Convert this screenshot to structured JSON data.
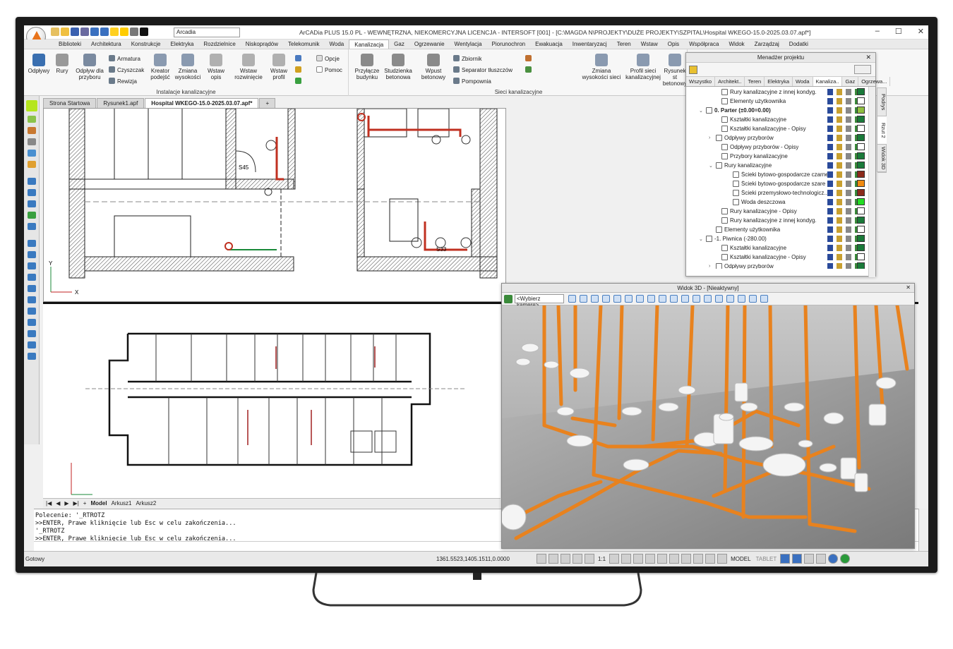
{
  "app": {
    "title": "ArCADia PLUS 15.0 PL - WEWNĘTRZNA, NIEKOMERCYJNA LICENCJA - INTERSOFT [001] - [C:\\MAGDA N\\PROJEKTY\\DUŻE PROJEKTY\\SZPITAL\\Hospital WKEGO-15.0-2025.03.07.apf*]",
    "font_selector": "Arcadia"
  },
  "menu": [
    "Biblioteki",
    "Architektura",
    "Konstrukcje",
    "Elektryka",
    "Rozdzielnice",
    "Niskoprądów",
    "Telekomunik",
    "Woda",
    "Kanalizacja",
    "Gaz",
    "Ogrzewanie",
    "Wentylacja",
    "Piorunochron",
    "Ewakuacja",
    "Inwentaryzacj",
    "Teren",
    "Wstaw",
    "Opis",
    "Współpraca",
    "Widok",
    "Zarządzaj",
    "Dodatki"
  ],
  "menu_active": "Kanalizacja",
  "ribbon": {
    "odplywy": "Odpływy",
    "rury": "Rury",
    "odplyw_przyb_1": "Odpływ dla",
    "odplyw_przyb_2": "przyboru",
    "armatura": "Armatura",
    "czyszczak": "Czyszczak",
    "rewizja": "Rewizja",
    "kreator_1": "Kreator",
    "kreator_2": "podejść",
    "zmiana_wys_1": "Zmiana",
    "zmiana_wys_2": "wysokości",
    "wstaw_opis_1": "Wstaw",
    "wstaw_opis_2": "opis",
    "wstaw_rozw_1": "Wstaw",
    "wstaw_rozw_2": "rozwinięcie",
    "wstaw_profil_1": "Wstaw",
    "wstaw_profil_2": "profil",
    "opcje": "Opcje",
    "pomoc": "Pomoc",
    "group_instalacje": "Instalacje kanalizacyjne",
    "przylacze_1": "Przyłącze",
    "przylacze_2": "budynku",
    "studzienka_1": "Studzienka",
    "studzienka_2": "betonowa",
    "wpust_1": "Wpust",
    "wpust_2": "betonowy",
    "zbiornik": "Zbiornik",
    "separator": "Separator tłuszczów",
    "pompownia": "Pompownia",
    "zmiana_sieci_1": "Zmiana",
    "zmiana_sieci_2": "wysokości sieci",
    "profil_sieci_1": "Profil sieci",
    "profil_sieci_2": "kanalizacyjnej",
    "rysunek_1": "Rysunek st",
    "rysunek_2": "betonowy",
    "group_sieci": "Sieci kanalizacyjne"
  },
  "doc_tabs": [
    "Strona Startowa",
    "Rysunek1.apf",
    "Hospital WKEGO-15.0-2025.03.07.apf*"
  ],
  "doc_tab_active": 2,
  "model_tabs": [
    "Model",
    "Arkusz1",
    "Arkusz2"
  ],
  "command_lines": [
    "Polecenie: '_RTROTZ",
    ">>ENTER, Prawe kliknięcie lub Esc w celu zakończenia...",
    "'_RTROTZ",
    ">>ENTER, Prawe kliknięcie lub Esc w celu zakończenia..."
  ],
  "status": {
    "ready": "Gotowy",
    "coords": "1361.5523,1405.1511,0.0000",
    "scale": "1:1",
    "model": "MODEL",
    "tablet": "TABLET"
  },
  "project_manager": {
    "title": "Menadżer projektu",
    "tabs": [
      "Wszystko",
      "Architekt..",
      "Teren",
      "Elektryka",
      "Woda",
      "Kanaliza..",
      "Gaz",
      "Ogrzewa..."
    ],
    "tab_active": 5,
    "rows": [
      {
        "indent": 40,
        "label": "Rury kanalizacyjne z innej kondyg.",
        "exp": "",
        "bold": false,
        "color": "#1a7a3a"
      },
      {
        "indent": 40,
        "label": "Elementy użytkownika",
        "exp": "",
        "bold": false,
        "color": "#ffffff"
      },
      {
        "indent": 18,
        "label": "0. Parter (±0.00=0.00)",
        "exp": "⌄",
        "bold": true,
        "color": "#8fbf40"
      },
      {
        "indent": 40,
        "label": "Kształtki kanalizacyjne",
        "exp": "",
        "bold": false,
        "color": "#1a7a3a"
      },
      {
        "indent": 40,
        "label": "Kształtki kanalizacyjne - Opisy",
        "exp": "",
        "bold": false,
        "color": "#ffffff"
      },
      {
        "indent": 32,
        "label": "Odpływy przyborów",
        "exp": "›",
        "bold": false,
        "color": "#1a7a3a"
      },
      {
        "indent": 40,
        "label": "Odpływy przyborów - Opisy",
        "exp": "",
        "bold": false,
        "color": "#ffffff"
      },
      {
        "indent": 40,
        "label": "Przybory kanalizacyjne",
        "exp": "",
        "bold": false,
        "color": "#1a7a3a"
      },
      {
        "indent": 32,
        "label": "Rury kanalizacyjne",
        "exp": "⌄",
        "bold": false,
        "color": "#1a7a3a"
      },
      {
        "indent": 56,
        "label": "Ścieki bytowo-gospodarcze czarne",
        "exp": "",
        "bold": false,
        "color": "#8b2a1a"
      },
      {
        "indent": 56,
        "label": "Ścieki bytowo-gospodarcze szare",
        "exp": "",
        "bold": false,
        "color": "#f08a10"
      },
      {
        "indent": 56,
        "label": "Ścieki przemysłowo-technologicz..",
        "exp": "",
        "bold": false,
        "color": "#8b2a1a"
      },
      {
        "indent": 56,
        "label": "Woda deszczowa",
        "exp": "",
        "bold": false,
        "color": "#22dd22"
      },
      {
        "indent": 40,
        "label": "Rury kanalizacyjne - Opisy",
        "exp": "",
        "bold": false,
        "color": "#ffffff"
      },
      {
        "indent": 40,
        "label": "Rury kanalizacyjne z innej kondyg.",
        "exp": "",
        "bold": false,
        "color": "#1a7a3a"
      },
      {
        "indent": 32,
        "label": "Elementy użytkownika",
        "exp": "",
        "bold": false,
        "color": "#ffffff"
      },
      {
        "indent": 18,
        "label": "-1. Piwnica (-280.00)",
        "exp": "⌄",
        "bold": false,
        "color": "#1a7a3a"
      },
      {
        "indent": 40,
        "label": "Kształtki kanalizacyjne",
        "exp": "",
        "bold": false,
        "color": "#1a7a3a"
      },
      {
        "indent": 40,
        "label": "Kształtki kanalizacyjne - Opisy",
        "exp": "",
        "bold": false,
        "color": "#ffffff"
      },
      {
        "indent": 32,
        "label": "Odpływy przyborów",
        "exp": "›",
        "bold": false,
        "color": "#1a7a3a"
      }
    ]
  },
  "side_tabs": [
    "Podrys",
    "Rzut 2",
    "Widok 3D"
  ],
  "view3d": {
    "title": "Widok 3D - [Nieaktywny]",
    "camera": "<Wybierz kamerę>"
  },
  "drawing_labels": {
    "s45": "S45",
    "s33": "S33",
    "axis_y": "Y",
    "axis_x": "X"
  },
  "colors": {
    "accent": "#f08a10",
    "pipe": "#e8821e",
    "wall": "#333333",
    "selection_green": "#b5e61d"
  }
}
